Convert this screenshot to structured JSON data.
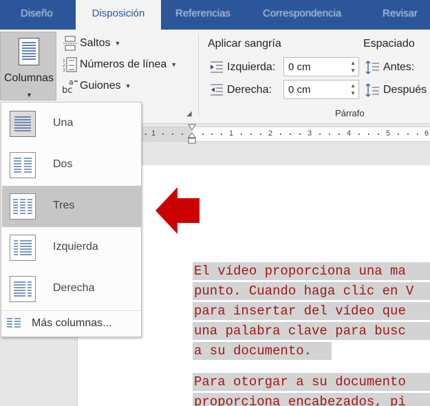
{
  "tabs": [
    {
      "label": "Diseño",
      "active": false
    },
    {
      "label": "Disposición",
      "active": true
    },
    {
      "label": "Referencias",
      "active": false
    },
    {
      "label": "Correspondencia",
      "active": false
    },
    {
      "label": "Revisar",
      "active": false
    }
  ],
  "ribbon": {
    "columns_label": "Columnas",
    "saltos_label": "Saltos",
    "numeros_label": "Números de línea",
    "guiones_label": "Guiones",
    "sangria_title": "Aplicar sangría",
    "espaciado_title": "Espaciado",
    "izquierda_label": "Izquierda:",
    "izquierda_value": "0 cm",
    "derecha_label": "Derecha:",
    "derecha_value": "0 cm",
    "antes_label": "Antes:",
    "despues_label": "Después",
    "paragraph_group": "Párrafo"
  },
  "ruler": {
    "labels": [
      "1",
      "1",
      "2",
      "3",
      "4",
      "5",
      "6"
    ]
  },
  "menu": {
    "items": [
      {
        "label": "Una",
        "icon": "one-column-icon"
      },
      {
        "label": "Dos",
        "icon": "two-columns-icon"
      },
      {
        "label": "Tres",
        "icon": "three-columns-icon"
      },
      {
        "label": "Izquierda",
        "icon": "left-column-icon"
      },
      {
        "label": "Derecha",
        "icon": "right-column-icon"
      }
    ],
    "highlighted_index": 2,
    "more_label": "Más columnas..."
  },
  "document": {
    "lines": [
      "El vídeo proporciona una ma",
      "punto. Cuando haga clic en V",
      "para insertar del vídeo que",
      "una palabra clave para busc",
      "a su documento.",
      "Para otorgar a su documento",
      "proporciona encabezados, pi"
    ]
  },
  "colors": {
    "tab_bar": "#2b579a",
    "text_highlight": "#d3d3d3",
    "document_text": "#a01818",
    "arrow": "#cc0000",
    "menu_highlight": "#c6c6c6"
  }
}
